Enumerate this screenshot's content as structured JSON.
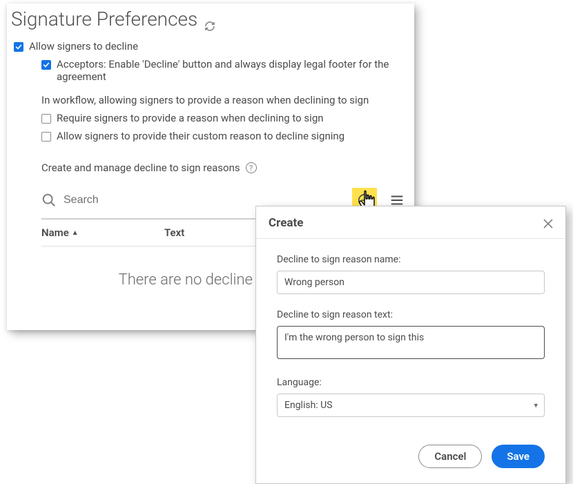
{
  "page": {
    "title": "Signature Preferences"
  },
  "options": {
    "allowDecline": {
      "checked": true,
      "label": "Allow signers to decline"
    },
    "acceptors": {
      "checked": true,
      "label": "Acceptors: Enable 'Decline' button and always display legal footer for the agreement"
    },
    "workflowHeading": "In workflow, allowing signers to provide a reason when declining to sign",
    "requireReason": {
      "checked": false,
      "label": "Require signers to provide a reason when declining to sign"
    },
    "allowCustomReason": {
      "checked": false,
      "label": "Allow signers to provide their custom reason to decline signing"
    }
  },
  "reasons": {
    "heading": "Create and manage decline to sign reasons",
    "searchPlaceholder": "Search",
    "columns": {
      "name": "Name",
      "text": "Text"
    },
    "emptyMessage": "There are no decline reasons"
  },
  "modal": {
    "title": "Create",
    "nameLabel": "Decline to sign reason name:",
    "nameValue": "Wrong person",
    "textLabel": "Decline to sign reason text:",
    "textValue": "I'm the wrong person to sign this",
    "languageLabel": "Language:",
    "languageValue": "English: US",
    "cancel": "Cancel",
    "save": "Save"
  }
}
